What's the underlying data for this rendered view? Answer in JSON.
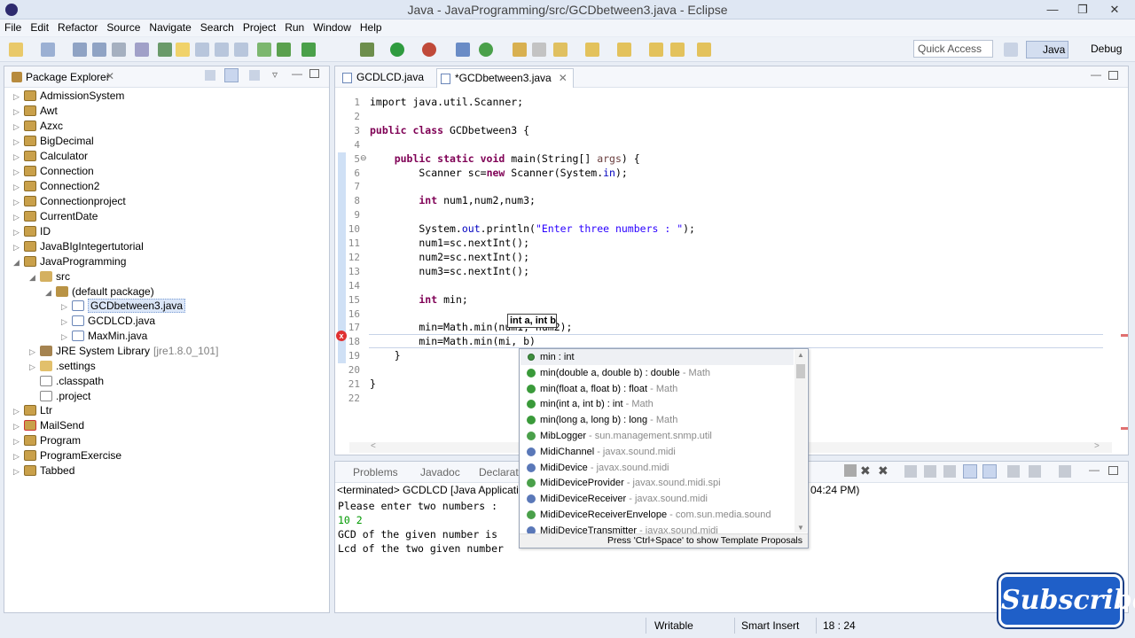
{
  "window": {
    "title": "Java - JavaProgramming/src/GCDbetween3.java - Eclipse"
  },
  "menu": [
    "File",
    "Edit",
    "Refactor",
    "Source",
    "Navigate",
    "Search",
    "Project",
    "Run",
    "Window",
    "Help"
  ],
  "toolbar": {
    "quick_access": "Quick Access",
    "perspective_java": "Java",
    "perspective_debug": "Debug"
  },
  "package_explorer": {
    "title": "Package Explorer",
    "items": [
      "AdmissionSystem",
      "Awt",
      "Azxc",
      "BigDecimal",
      "Calculator",
      "Connection",
      "Connection2",
      "Connectionproject",
      "CurrentDate",
      "ID",
      "JavaBIgIntegertutorial",
      "JavaProgramming",
      "src",
      "(default package)",
      "GCDbetween3.java",
      "GCDLCD.java",
      "MaxMin.java",
      "JRE System Library",
      "[jre1.8.0_101]",
      ".settings",
      ".classpath",
      ".project",
      "Ltr",
      "MailSend",
      "Program",
      "ProgramExercise",
      "Tabbed"
    ]
  },
  "editor": {
    "tabs": [
      "GCDLCD.java",
      "*GCDbetween3.java"
    ],
    "line_numbers": [
      "1",
      "2",
      "3",
      "4",
      "5",
      "6",
      "7",
      "8",
      "9",
      "10",
      "11",
      "12",
      "13",
      "14",
      "15",
      "16",
      "17",
      "18",
      "19",
      "20",
      "21",
      "22"
    ],
    "code": {
      "l1": "import java.util.Scanner;",
      "l3a": "public class",
      "l3b": " GCDbetween3 {",
      "l5a": "    public static void",
      "l5b": " main(String[] ",
      "l5c": "args",
      "l5d": ") {",
      "l6a": "        Scanner sc=",
      "l6b": "new",
      "l6c": " Scanner(System.",
      "l6d": "in",
      "l6e": ");",
      "l8a": "        int",
      "l8b": " num1,num2,num3;",
      "l10a": "        System.",
      "l10b": "out",
      "l10c": ".println(",
      "l10d": "\"Enter three numbers : \"",
      "l10e": ");",
      "l11": "        num1=sc.nextInt();",
      "l12": "        num2=sc.nextInt();",
      "l13": "        num3=sc.nextInt();",
      "l15a": "        int",
      "l15b": " min;",
      "l17": "        min=Math.min(num1, num2);",
      "l18": "        min=Math.min(mi, b)",
      "l19": "    }",
      "l21": "}"
    },
    "param_hint": "int a, int b"
  },
  "console": {
    "tabs": [
      "Problems",
      "Javadoc",
      "Declarat"
    ],
    "header": "<terminated> GCDLCD [Java Application",
    "header_time": "04:24 PM)",
    "lines": [
      "Please enter two numbers :",
      "10 2",
      "GCD of the given number is",
      "Lcd of the two given number"
    ]
  },
  "content_assist": {
    "items": [
      {
        "name": "min : int",
        "extra": "",
        "kind": "field"
      },
      {
        "name": "min(double a, double b) : double",
        "extra": " - Math",
        "kind": "method"
      },
      {
        "name": "min(float a, float b) : float",
        "extra": " - Math",
        "kind": "method"
      },
      {
        "name": "min(int a, int b) : int",
        "extra": " - Math",
        "kind": "method"
      },
      {
        "name": "min(long a, long b) : long",
        "extra": " - Math",
        "kind": "method"
      },
      {
        "name": "MibLogger",
        "extra": " - sun.management.snmp.util",
        "kind": "gclass"
      },
      {
        "name": "MidiChannel",
        "extra": " - javax.sound.midi",
        "kind": "iface"
      },
      {
        "name": "MidiDevice",
        "extra": " - javax.sound.midi",
        "kind": "iface"
      },
      {
        "name": "MidiDeviceProvider",
        "extra": " - javax.sound.midi.spi",
        "kind": "gclass"
      },
      {
        "name": "MidiDeviceReceiver",
        "extra": " - javax.sound.midi",
        "kind": "iface"
      },
      {
        "name": "MidiDeviceReceiverEnvelope",
        "extra": " - com.sun.media.sound",
        "kind": "gclass"
      },
      {
        "name": "MidiDeviceTransmitter",
        "extra": " - javax.sound.midi",
        "kind": "iface"
      }
    ],
    "footer": "Press 'Ctrl+Space' to show Template Proposals"
  },
  "status": {
    "writable": "Writable",
    "insert_mode": "Smart Insert",
    "position": "18 : 24"
  },
  "overlay": {
    "subscribe": "Subscribe"
  }
}
